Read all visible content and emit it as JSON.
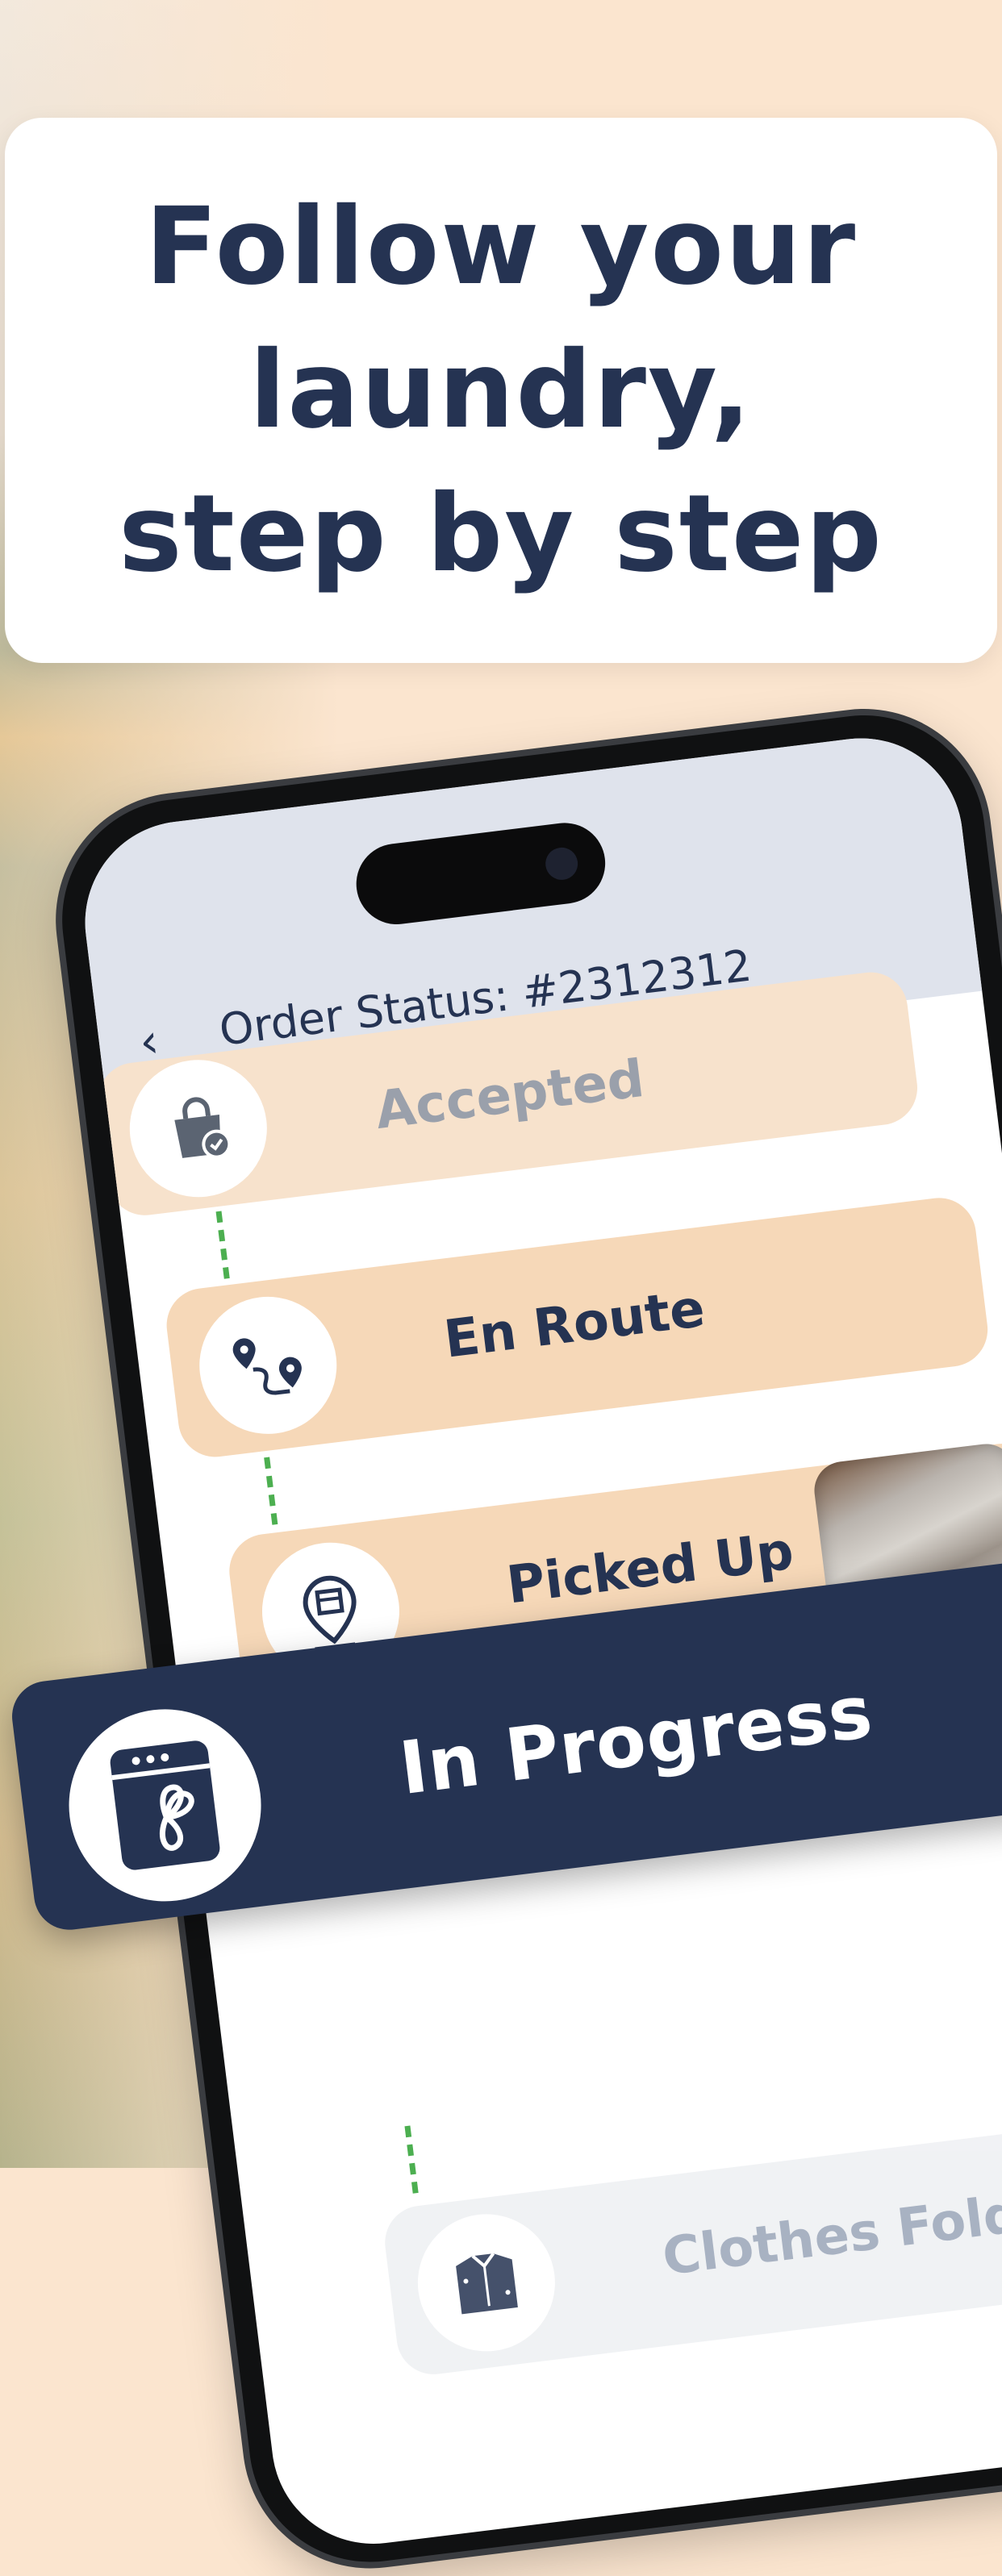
{
  "headline": {
    "lines": [
      "Follow your",
      "laundry,",
      "step by step"
    ]
  },
  "screen": {
    "back_icon": "back-chevron-icon",
    "back_glyph": "‹",
    "order_title": "Order Status: #2312312"
  },
  "steps": [
    {
      "label": "Accepted",
      "icon": "shopping-bag-check-icon"
    },
    {
      "label": "En Route",
      "icon": "route-pins-icon"
    },
    {
      "label": "Picked Up",
      "icon": "package-location-icon"
    },
    {
      "label": "In Progress",
      "icon": "washing-machine-icon"
    },
    {
      "label": "Clothes Folded",
      "icon": "folded-shirt-icon"
    }
  ],
  "colors": {
    "navy": "#253352",
    "peach": "#f6d8b8",
    "background": "#fbe5cf",
    "dash_green": "#4caf50"
  }
}
